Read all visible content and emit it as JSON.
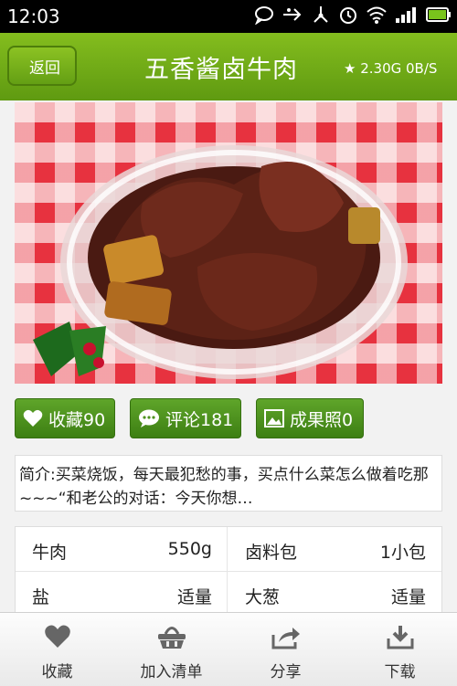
{
  "status_bar": {
    "time": "12:03"
  },
  "header": {
    "back_label": "返回",
    "title": "五香酱卤牛肉",
    "network": "★ 2.30G  0B/S"
  },
  "actions": {
    "favorite": "收藏90",
    "comment": "评论181",
    "photos": "成果照0"
  },
  "intro": "简介:买菜烧饭，每天最犯愁的事，买点什么菜怎么做着吃那~~~“和老公的对话：今天你想…",
  "ingredients": [
    {
      "name": "牛肉",
      "amount": "550g"
    },
    {
      "name": "卤料包",
      "amount": "1小包"
    },
    {
      "name": "盐",
      "amount": "适量"
    },
    {
      "name": "大葱",
      "amount": "适量"
    }
  ],
  "bottom_tabs": [
    {
      "label": "收藏",
      "icon": "heart-icon"
    },
    {
      "label": "加入清单",
      "icon": "basket-icon"
    },
    {
      "label": "分享",
      "icon": "share-icon"
    },
    {
      "label": "下载",
      "icon": "download-icon"
    }
  ],
  "colors": {
    "header_green": "#6fae18",
    "button_green": "#4e931f"
  }
}
